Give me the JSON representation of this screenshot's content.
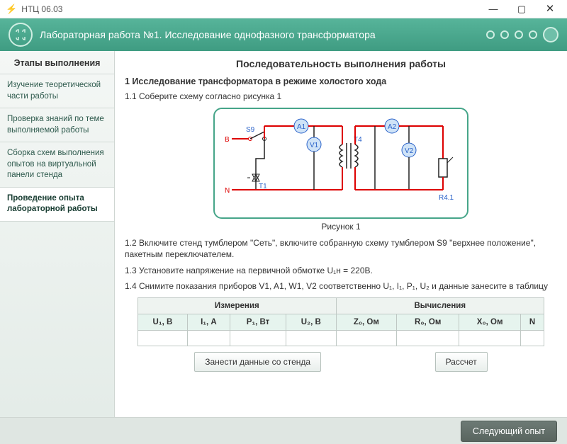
{
  "window": {
    "title": "НТЦ 06.03"
  },
  "header": {
    "lab_title": "Лабораторная работа №1. Исследование однофазного трансформатора"
  },
  "sidebar": {
    "header": "Этапы выполнения",
    "items": [
      {
        "label": "Изучение теоретической части работы"
      },
      {
        "label": "Проверка знаний по теме выполняемой работы"
      },
      {
        "label": "Сборка схем выполнения опытов на виртуальной панели стенда"
      },
      {
        "label": "Проведение опыта лабораторной работы"
      }
    ],
    "active": 3
  },
  "main": {
    "title": "Последовательность выполнения работы",
    "section1": "1 Исследование трансформатора в режиме холостого хода",
    "p11": "1.1 Соберите схему согласно рисунка 1",
    "figcap": "Рисунок 1",
    "p12": "1.2 Включите стенд тумблером \"Сеть\", включите собранную схему  тумблером S9 \"верхнее положение\", пакетным переключателем.",
    "p13": "1.3 Установите напряжение на первичной обмотке U₁н = 220В.",
    "p14": "1.4 Снимите показания приборов  V1, A1, W1, V2 соответственно U₁, I₁, P₁, U₂ и данные занесите в таблицу"
  },
  "circuit": {
    "B": "B",
    "N": "N",
    "S9": "S9",
    "T1": "T1",
    "A1": "A1",
    "V1": "V1",
    "T4": "T4",
    "A2": "A2",
    "V2": "V2",
    "R41": "R4.1"
  },
  "table": {
    "group_meas": "Измерения",
    "group_calc": "Вычисления",
    "cols": [
      "U₁, В",
      "I₁, А",
      "P₁, Вт",
      "U₂, В",
      "Z₀, Ом",
      "R₀, Ом",
      "X₀, Ом",
      "N"
    ],
    "row": [
      "",
      "",
      "",
      "",
      "",
      "",
      "",
      ""
    ]
  },
  "buttons": {
    "load": "Занести данные со стенда",
    "calc": "Рассчет",
    "next": "Следующий опыт"
  }
}
